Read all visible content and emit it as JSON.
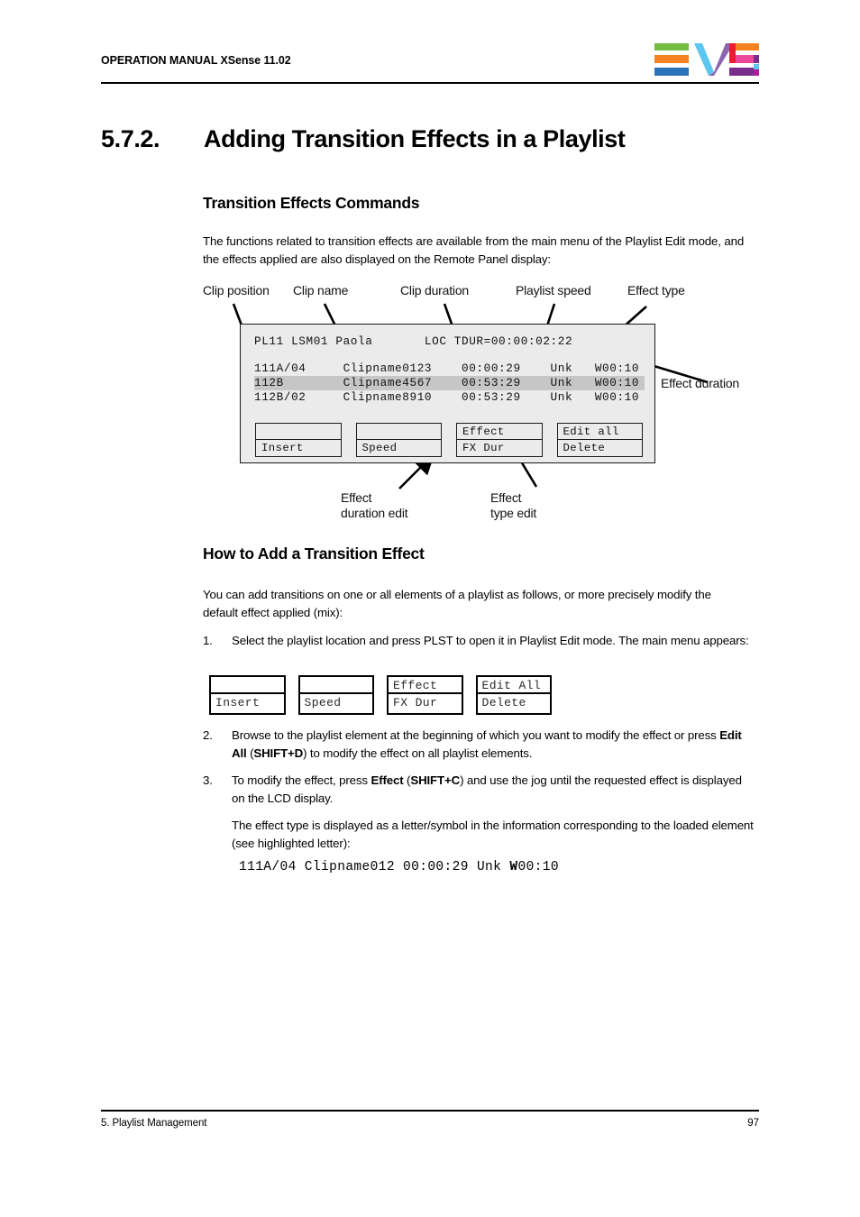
{
  "header": {
    "title": "OPERATION MANUAL  XSense 11.02",
    "logo_alt": "EVS",
    "logo_colors": {
      "green": "#76bc43",
      "orange": "#f58220",
      "blue": "#2b72b8",
      "cyan": "#5bc6f0",
      "purple": "#8c64b0",
      "red": "#ed1b34",
      "pink": "#ec4899",
      "violet": "#7b2d8e",
      "magenta": "#b5179e"
    }
  },
  "section": {
    "number": "5.7.2.",
    "title": "Adding Transition Effects in a Playlist"
  },
  "commands": {
    "heading": "Transition Effects Commands",
    "intro": "The functions related to transition effects are available from the main menu of the Playlist Edit mode, and the effects applied are also displayed on the Remote Panel display:"
  },
  "figure1": {
    "annotations": {
      "clip_position": "Clip position",
      "clip_name": "Clip name",
      "clip_duration": "Clip duration",
      "playlist_speed": "Playlist speed",
      "effect_type": "Effect type",
      "effect_duration": "Effect duration",
      "effect_duration_edit_l1": "Effect",
      "effect_duration_edit_l2": "duration edit",
      "effect_type_edit_l1": "Effect",
      "effect_type_edit_l2": "type edit"
    },
    "lcd": {
      "header_line": "PL11 LSM01 Paola       LOC TDUR=00:00:02:22",
      "rows": [
        {
          "position": "111A/04",
          "name": "Clipname0123",
          "duration": "00:00:29",
          "speed": "Unk",
          "effect": "W00:10",
          "text": "111A/04     Clipname0123    00:00:29    Unk   W00:10",
          "highlighted": false
        },
        {
          "position": "112B",
          "name": "Clipname4567",
          "duration": "00:53:29",
          "speed": "Unk",
          "effect": "W00:10",
          "text": "112B        Clipname4567    00:53:29    Unk   W00:10",
          "highlighted": true
        },
        {
          "position": "112B/02",
          "name": "Clipname8910",
          "duration": "00:53:29",
          "speed": "Unk",
          "effect": "W00:10",
          "text": "112B/02     Clipname8910    00:53:29    Unk   W00:10",
          "highlighted": false
        }
      ],
      "buttons": [
        {
          "top": "",
          "bottom": "Insert"
        },
        {
          "top": "",
          "bottom": "Speed"
        },
        {
          "top": "Effect",
          "bottom": "FX Dur"
        },
        {
          "top": "Edit all",
          "bottom": "Delete"
        }
      ]
    }
  },
  "howto": {
    "heading": "How to Add a Transition Effect",
    "intro": "You can add transitions on one or all elements of a playlist as follows, or more precisely modify the default effect applied (mix):",
    "steps": [
      {
        "n": "1.",
        "text": "Select the playlist location and press PLST to open it in Playlist Edit mode. The main menu appears:"
      },
      {
        "n": "2.",
        "text": "Browse to the playlist element at the beginning of which you want to modify the effect or press Edit All (SHIFT+D) to modify the effect on all playlist elements."
      },
      {
        "n": "3.",
        "text": "To modify the effect, press Effect (SHIFT+C) and use the jog until the requested effect is displayed on the LCD display."
      }
    ],
    "effect_type_note": "The effect type is displayed as a letter/symbol in the information corresponding to the loaded element (see highlighted letter):",
    "code_prefix": "111A/04 Clipname012 00:00:29 Unk ",
    "code_highlight": "W",
    "code_suffix": "00:10"
  },
  "figure2": {
    "buttons": [
      {
        "top": "",
        "bottom": "Insert"
      },
      {
        "top": "",
        "bottom": "Speed"
      },
      {
        "top": "Effect",
        "bottom": "FX Dur"
      },
      {
        "top": "Edit All",
        "bottom": "Delete"
      }
    ]
  },
  "footer": {
    "chapter": "5. Playlist Management",
    "page": "97"
  }
}
